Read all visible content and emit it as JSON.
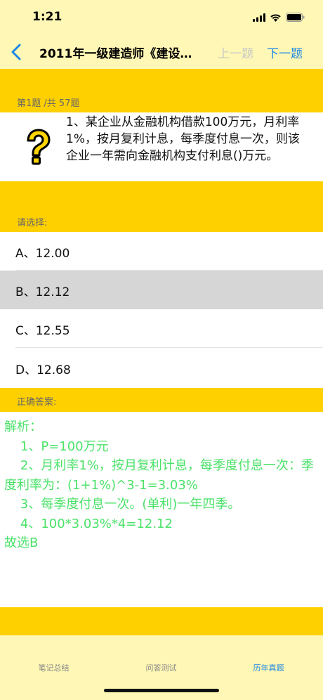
{
  "status_bar": {
    "time": "1:21"
  },
  "nav": {
    "title": "2011年一级建造师《建设…",
    "prev_label": "上一题",
    "next_label": "下一题"
  },
  "question": {
    "counter": "第1题 /共 57题",
    "text": "1、某企业从金融机构借款100万元，月利率1%，按月复利计息，每季度付息一次，则该企业一年需向金融机构支付利息()万元。"
  },
  "choose_label": "请选择:",
  "options": [
    {
      "label": "A、12.00",
      "selected": false
    },
    {
      "label": "B、12.12",
      "selected": true
    },
    {
      "label": "C、12.55",
      "selected": false
    },
    {
      "label": "D、12.68",
      "selected": false
    }
  ],
  "answer_label": "正确答案:",
  "analysis": {
    "lines": [
      "解析：",
      "    1、P=100万元",
      "    2、月利率1%，按月复利计息，每季度付息一次：季度利率为：(1+1%)^3-1=3.03%",
      "    3、每季度付息一次。(单利)一年四季。",
      "    4、100*3.03%*4=12.12",
      "故选B"
    ]
  },
  "tabs": [
    {
      "label": "笔记总结",
      "active": false
    },
    {
      "label": "问答测试",
      "active": false
    },
    {
      "label": "历年真题",
      "active": true
    }
  ],
  "colors": {
    "header_bg": "#fff7b5",
    "band": "#ffd000",
    "accent": "#1e88e5",
    "analysis_text": "#4ce26a",
    "selected_option": "#d6d6d6"
  }
}
